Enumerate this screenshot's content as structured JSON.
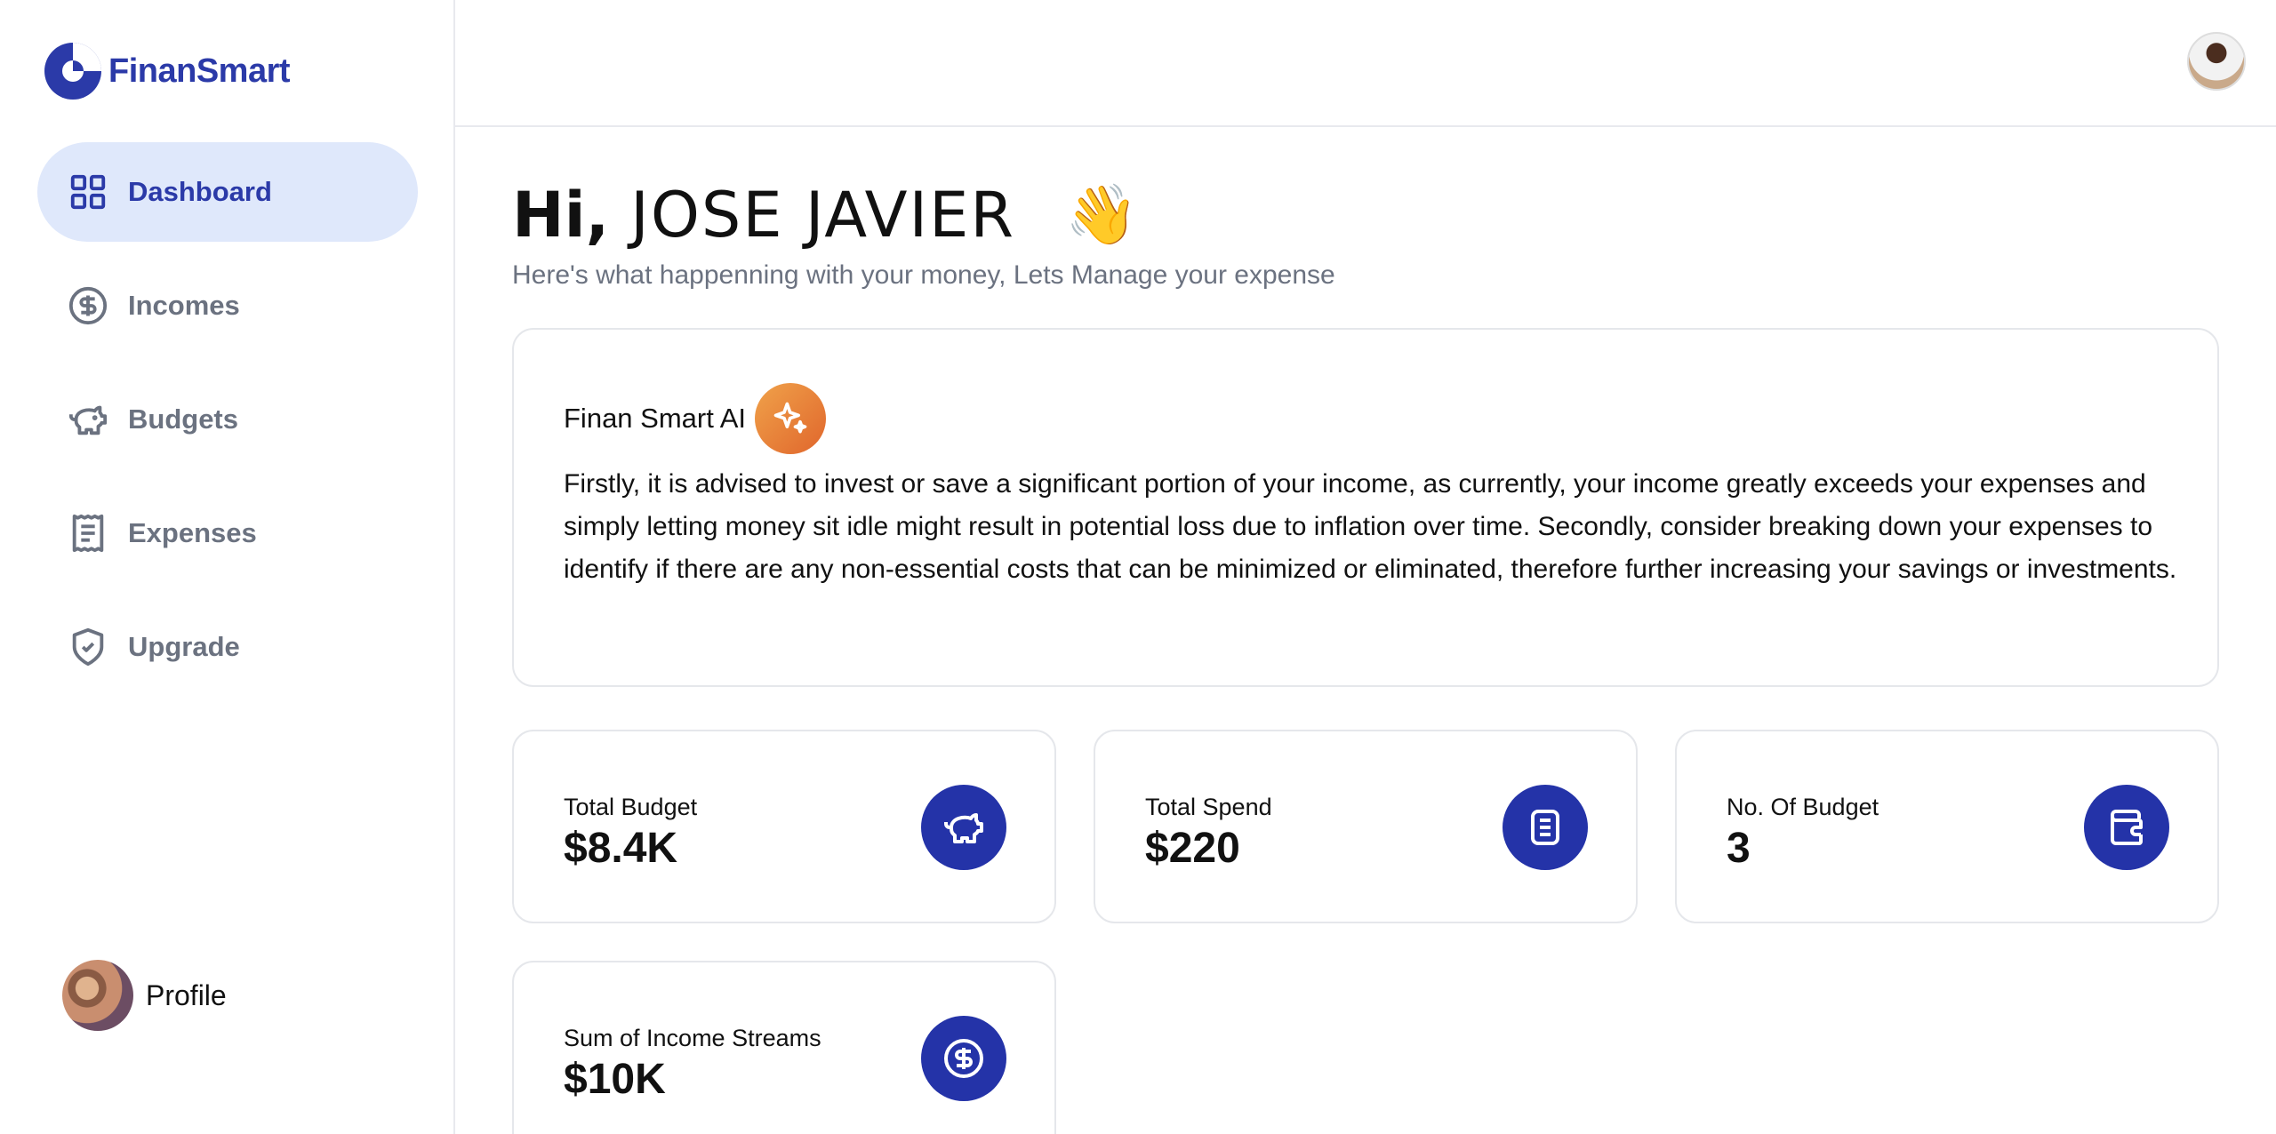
{
  "app": {
    "name": "FinanSmart"
  },
  "colors": {
    "brand": "#2b3aa8",
    "active_bg": "#dfe8fb",
    "icon_circle": "#2433a8",
    "ai_badge": "#e8823a"
  },
  "sidebar": {
    "items": [
      {
        "label": "Dashboard",
        "icon": "dashboard-grid-icon",
        "active": true
      },
      {
        "label": "Incomes",
        "icon": "dollar-circle-icon"
      },
      {
        "label": "Budgets",
        "icon": "piggy-bank-icon"
      },
      {
        "label": "Expenses",
        "icon": "receipt-icon"
      },
      {
        "label": "Upgrade",
        "icon": "shield-check-icon"
      }
    ],
    "profile_label": "Profile"
  },
  "header": {
    "hi": "Hi,",
    "name": "JOSE JAVIER",
    "wave": "👋",
    "subtitle": "Here's what happenning with your money, Lets Manage your expense"
  },
  "ai": {
    "title": "Finan Smart AI",
    "text": "Firstly, it is advised to invest or save a significant portion of your income, as currently, your income greatly exceeds your expenses and simply letting money sit idle might result in potential loss due to inflation over time. Secondly, consider breaking down your expenses to identify if there are any non-essential costs that can be minimized or eliminated, therefore further increasing your savings or investments."
  },
  "stats": [
    {
      "label": "Total Budget",
      "value": "$8.4K",
      "icon": "piggy-bank-icon"
    },
    {
      "label": "Total Spend",
      "value": "$220",
      "icon": "receipt-icon"
    },
    {
      "label": "No. Of Budget",
      "value": "3",
      "icon": "wallet-icon"
    },
    {
      "label": "Sum of Income Streams",
      "value": "$10K",
      "icon": "dollar-circle-icon"
    }
  ]
}
